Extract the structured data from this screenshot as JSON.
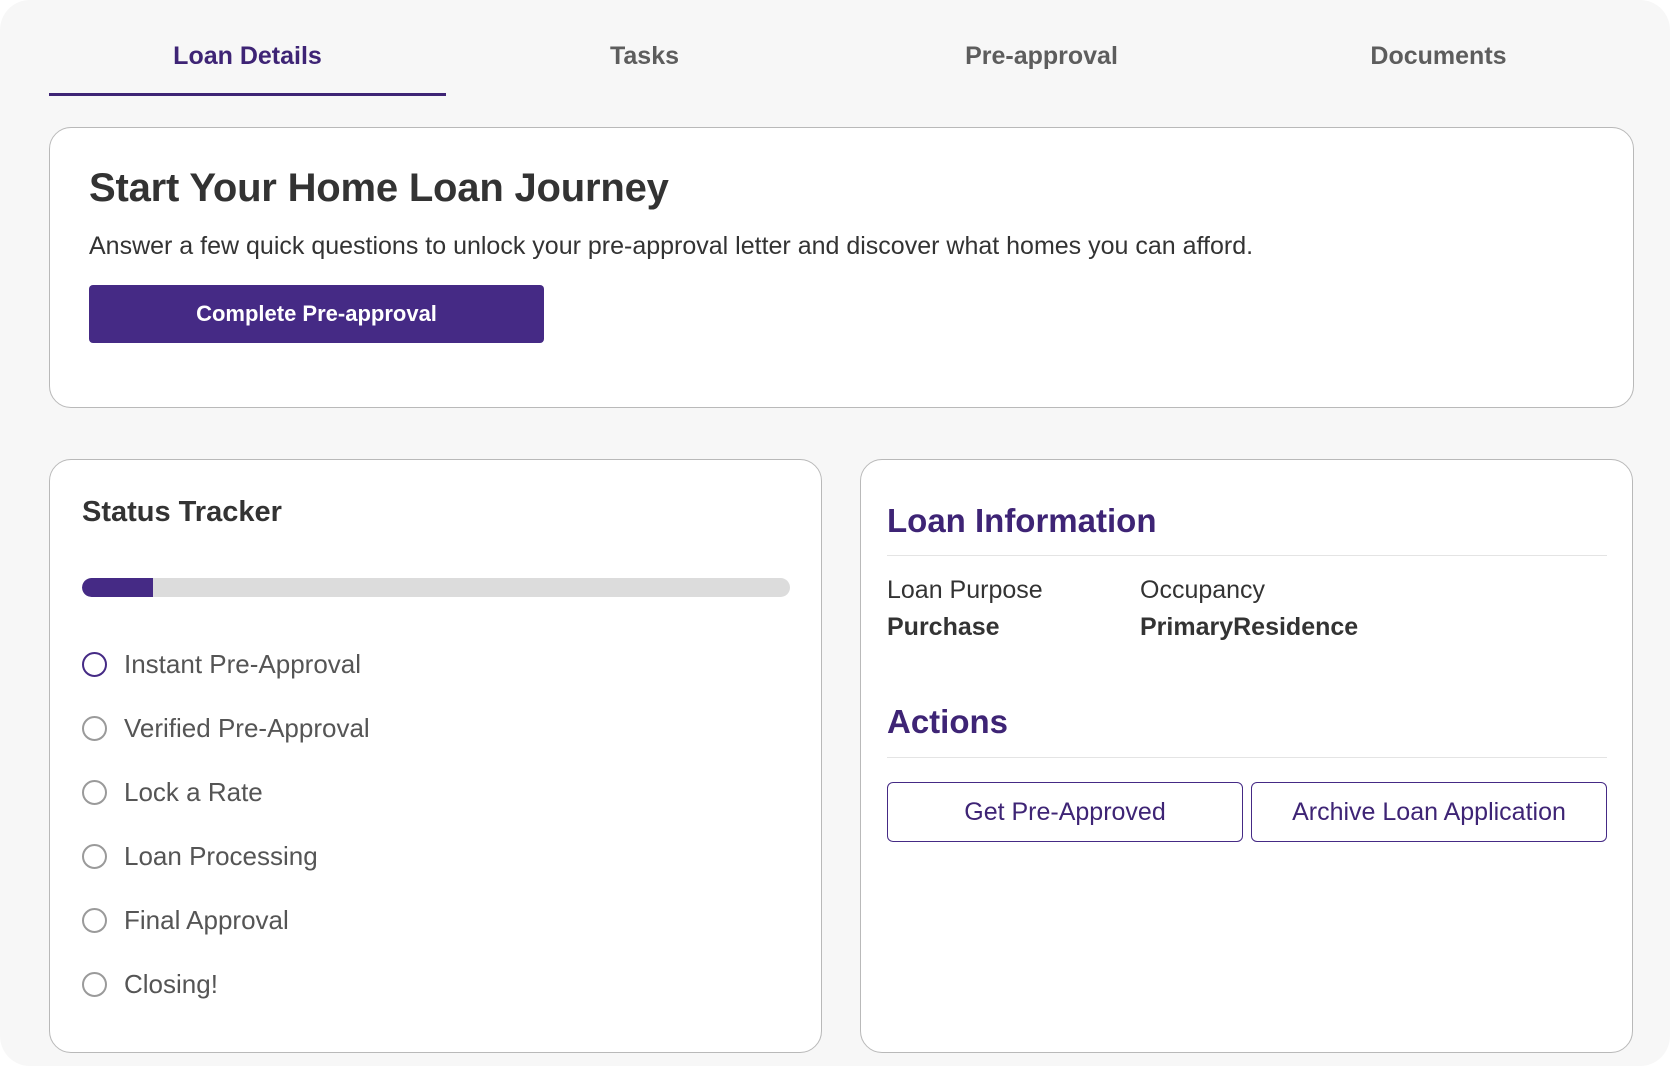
{
  "tabs": [
    {
      "label": "Loan Details",
      "active": true
    },
    {
      "label": "Tasks",
      "active": false
    },
    {
      "label": "Pre-approval",
      "active": false
    },
    {
      "label": "Documents",
      "active": false
    }
  ],
  "hero": {
    "title": "Start Your Home Loan Journey",
    "description": "Answer a few quick questions to unlock your pre-approval letter and discover what homes you can afford.",
    "button_label": "Complete Pre-approval"
  },
  "status_tracker": {
    "title": "Status Tracker",
    "progress_fraction": 0.1,
    "steps": [
      {
        "label": "Instant Pre-Approval",
        "current": true,
        "icon": "circle-outline-icon"
      },
      {
        "label": "Verified Pre-Approval",
        "current": false,
        "icon": "circle-outline-icon"
      },
      {
        "label": "Lock a Rate",
        "current": false,
        "icon": "circle-outline-icon"
      },
      {
        "label": "Loan Processing",
        "current": false,
        "icon": "circle-outline-icon"
      },
      {
        "label": "Final Approval",
        "current": false,
        "icon": "circle-outline-icon"
      },
      {
        "label": "Closing!",
        "current": false,
        "icon": "circle-outline-icon"
      }
    ]
  },
  "loan_information": {
    "heading": "Loan Information",
    "fields": [
      {
        "label": "Loan Purpose",
        "value": "Purchase"
      },
      {
        "label": "Occupancy",
        "value": "PrimaryResidence"
      }
    ]
  },
  "actions": {
    "heading": "Actions",
    "get_preapproved_label": "Get Pre-Approved",
    "archive_label": "Archive Loan Application"
  },
  "colors": {
    "accent": "#452a85",
    "accent_text": "#3e2475",
    "page_background": "#f7f7f7",
    "progress_track": "#dcdcdc"
  }
}
